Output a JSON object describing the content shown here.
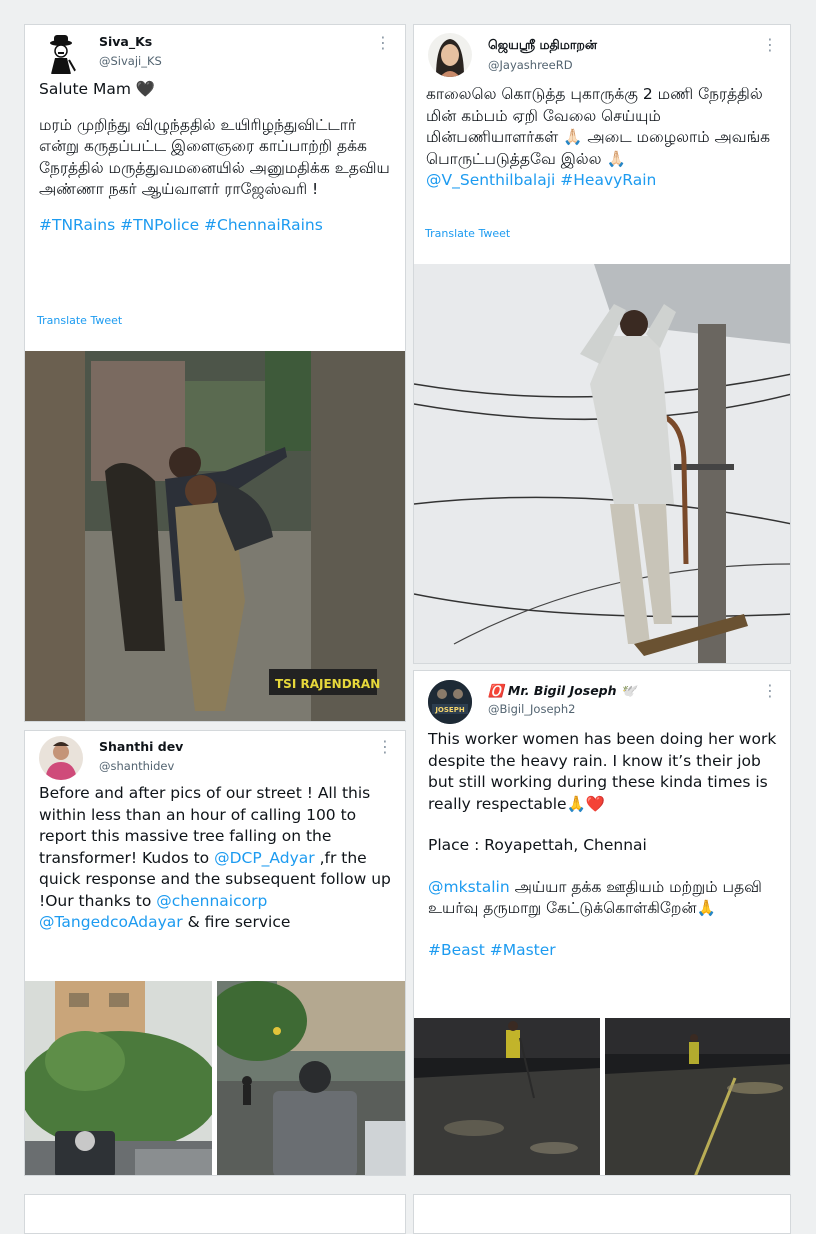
{
  "tweets": {
    "t1": {
      "name": "Siva_Ks",
      "handle": "@Sivaji_KS",
      "line1": "Salute Mam 🖤",
      "para": "மரம் முறிந்து விழுந்ததில் உயிரிழந்துவிட்டார் என்று கருதப்பட்ட இளைஞரை காப்பாற்றி தக்க நேரத்தில் மருத்துவமனையில் அனுமதிக்க உதவிய அண்ணா நகர் ஆய்வாளர் ராஜேஸ்வரி !",
      "hashtags": "#TNRains #TNPolice #ChennaiRains",
      "translate": "Translate Tweet",
      "watermark": "TSI RAJENDRAN"
    },
    "t2": {
      "name": "ஜெயஶ்ரீ மதிமாறன்",
      "handle": "@JayashreeRD",
      "para": "காலைலெ கொடுத்த புகாருக்கு 2 மணி நேரத்தில் மின் கம்பம் ஏறி வேலை செய்யும் மின்பணியாளர்கள் 🙏🏻 அடை மழைலாம் அவங்க பொருட்படுத்தவே இல்ல 🙏🏻",
      "mention": "@V_Senthilbalaji",
      "hashtag": "#HeavyRain",
      "translate": "Translate Tweet"
    },
    "t3": {
      "name": "Shanthi dev",
      "handle": "@shanthidev",
      "para_a": "Before and after pics of our street ! All this within less than an hour of calling 100  to report this massive tree falling on the transformer! Kudos to",
      "mention1": "@DCP_Adyar",
      "para_b": " ,fr the quick response and the subsequent follow up !Our thanks to",
      "mention2": "@chennaicorp",
      "mention3": "@TangedcoAdayar",
      "para_c": " & fire service"
    },
    "t4": {
      "name": "🅾️ Mr. Bigil Joseph 🕊️",
      "handle": "@Bigil_Joseph2",
      "avatar_text": "JOSEPH",
      "para": "This worker women has been doing her work despite the heavy rain. I know it’s their job but still working during these kinda times is really respectable🙏❤️",
      "place": "Place : Royapettah, Chennai",
      "mention": "@mkstalin",
      "tamil": " அய்யா தக்க ஊதியம் மற்றும் பதவி உயர்வு தருமாறு கேட்டுக்கொள்கிறேன்🙏",
      "hashtags": "#Beast #Master"
    }
  },
  "icons": {
    "more": "more-dots-icon"
  },
  "colors": {
    "link": "#1d9bf0",
    "text": "#0f1419",
    "muted": "#536471",
    "bg": "#eef0f1"
  }
}
